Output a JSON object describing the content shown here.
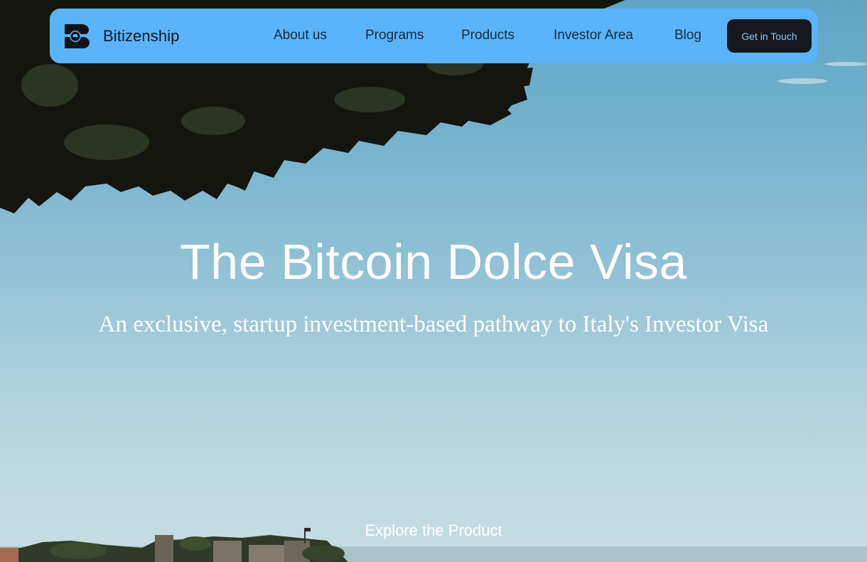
{
  "brand": {
    "name": "Bitizenship",
    "logo_icon": "bitizenship-b-logo",
    "nav_color": "#5ab4fb"
  },
  "nav": {
    "items": [
      {
        "label": "About us"
      },
      {
        "label": "Programs"
      },
      {
        "label": "Products"
      },
      {
        "label": "Investor Area"
      },
      {
        "label": "Blog"
      }
    ],
    "cta_label": "Get in Touch"
  },
  "hero": {
    "title": "The Bitcoin Dolce Visa",
    "subtitle": "An exclusive, startup investment-based pathway to Italy's Investor Visa",
    "explore_label": "Explore the Product",
    "background_image": "sky-with-pine-branches-and-hilltop-castle"
  }
}
